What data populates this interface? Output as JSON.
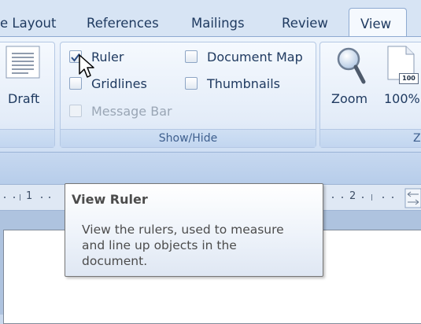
{
  "tabs": {
    "page_layout": "e Layout",
    "references": "References",
    "mailings": "Mailings",
    "review": "Review",
    "view": "View"
  },
  "ribbon": {
    "draft_label": "Draft",
    "show_hide": {
      "caption": "Show/Hide",
      "ruler": {
        "label": "Ruler",
        "checked": true
      },
      "gridlines": {
        "label": "Gridlines",
        "checked": false
      },
      "message_bar": {
        "label": "Message Bar",
        "checked": false,
        "disabled": true
      },
      "document_map": {
        "label": "Document Map",
        "checked": false
      },
      "thumbnails": {
        "label": "Thumbnails",
        "checked": false
      }
    },
    "zoom_label": "Zoom",
    "hundred_label": "100%",
    "hundred_icon_text": "100",
    "zoom_group_caption_partial": "Z"
  },
  "ruler": {
    "tick_1": "1",
    "tick_2": "2"
  },
  "tooltip": {
    "title": "View Ruler",
    "body": "View the rulers, used to measure\nand line up objects in the\ndocument."
  },
  "colors": {
    "ribbon_text": "#1f3a60",
    "group_caption": "#3e5f8e",
    "tooltip_text": "#4c4c4c"
  }
}
